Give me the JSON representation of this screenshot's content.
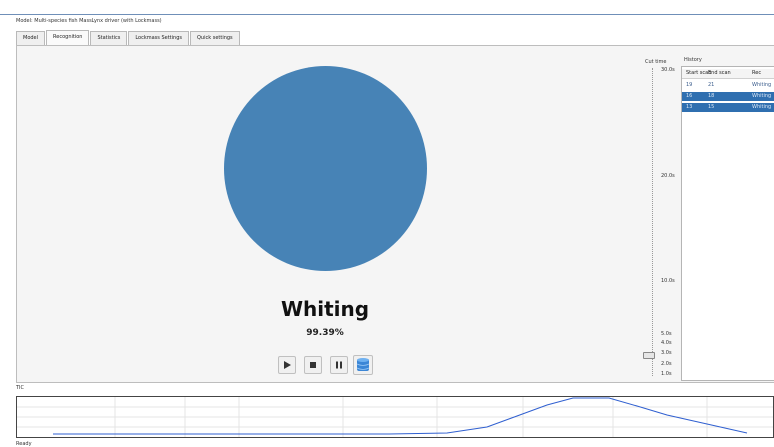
{
  "window": {
    "title": "Model: Multi-species fish MassLynx driver (with Lockmass)"
  },
  "tabs": [
    {
      "label": "Model",
      "active": false
    },
    {
      "label": "Recognition",
      "active": true
    },
    {
      "label": "Statistics",
      "active": false
    },
    {
      "label": "Lockmass Settings",
      "active": false
    },
    {
      "label": "Quick settings",
      "active": false
    }
  ],
  "result": {
    "species": "Whiting",
    "score": "99.39%",
    "circle_color": "#4783b6"
  },
  "controls": {
    "play": "play-icon",
    "stop": "stop-icon",
    "pause": "pause-icon",
    "database": "database-icon"
  },
  "cuttime": {
    "label": "Cut time",
    "ticks": [
      "30.0s",
      "20.0s",
      "10.0s",
      "5.0s",
      "4.0s",
      "3.0s",
      "2.0s",
      "1.0s"
    ],
    "value_s": 3.0
  },
  "history": {
    "label": "History",
    "columns": [
      "Start scan",
      "End scan",
      "Rec"
    ],
    "rows": [
      {
        "start": "19",
        "end": "21",
        "rec": "Whiting",
        "selected": false
      },
      {
        "start": "16",
        "end": "18",
        "rec": "Whiting",
        "selected": true
      },
      {
        "start": "13",
        "end": "15",
        "rec": "Whiting",
        "selected": true
      }
    ]
  },
  "tic": {
    "label": "TIC",
    "line_color": "#2f5fd0"
  },
  "status": {
    "text": "Ready"
  }
}
